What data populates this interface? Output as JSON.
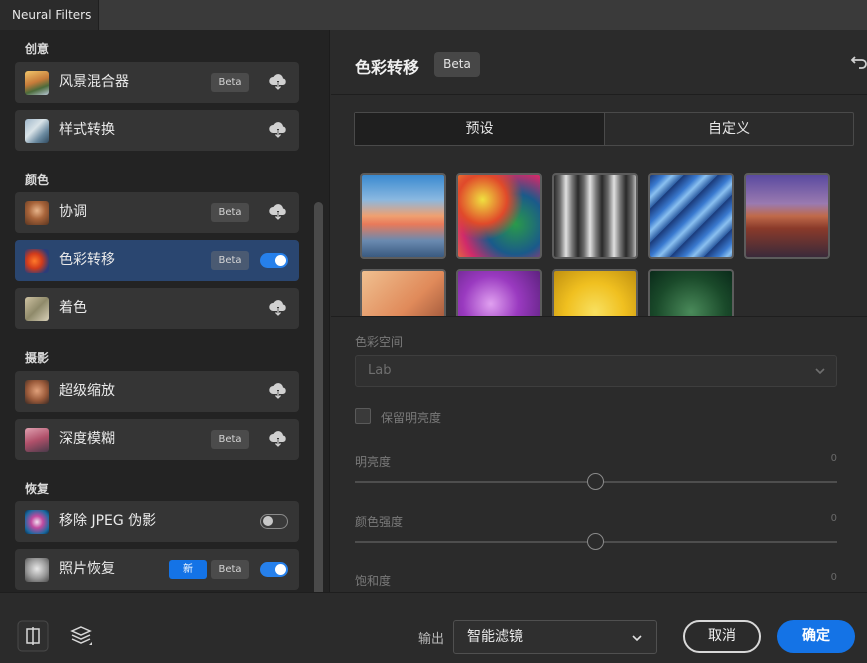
{
  "window": {
    "tab_title": "Neural Filters"
  },
  "sidebar": {
    "categories": {
      "creative": "创意",
      "color": "颜色",
      "photography": "摄影",
      "restoration": "恢复"
    },
    "items": [
      {
        "label": "风景混合器",
        "badge": "Beta",
        "action": "cloud-download-icon"
      },
      {
        "label": "样式转换",
        "action": "cloud-download-icon"
      },
      {
        "label": "协调",
        "badge": "Beta",
        "action": "cloud-download-icon"
      },
      {
        "label": "色彩转移",
        "badge": "Beta",
        "action": "toggle",
        "enabled": true,
        "selected": true
      },
      {
        "label": "着色",
        "action": "cloud-download-icon"
      },
      {
        "label": "超级缩放",
        "action": "cloud-download-icon"
      },
      {
        "label": "深度模糊",
        "badge": "Beta",
        "action": "cloud-download-icon"
      },
      {
        "label": "移除 JPEG 伪影",
        "action": "toggle",
        "enabled": false
      },
      {
        "label": "照片恢复",
        "new_badge": "新",
        "badge": "Beta",
        "action": "toggle",
        "enabled": true
      }
    ]
  },
  "panel": {
    "title": "色彩转移",
    "badge": "Beta",
    "tabs": {
      "preset": "预设",
      "custom": "自定义",
      "selected": "预设"
    },
    "color_space": {
      "label": "色彩空间",
      "value": "Lab"
    },
    "preserve_luminance": {
      "label": "保留明亮度",
      "checked": false
    },
    "sliders": [
      {
        "label": "明亮度",
        "value": "0",
        "level": 0.5
      },
      {
        "label": "颜色强度",
        "value": "0",
        "level": 0.5
      },
      {
        "label": "饱和度",
        "value": "0"
      }
    ]
  },
  "footer": {
    "output_label": "输出",
    "output_value": "智能滤镜",
    "cancel": "取消",
    "ok": "确定"
  },
  "colors": {
    "accent": "#1473e6",
    "selected_item": "#2a4670"
  }
}
